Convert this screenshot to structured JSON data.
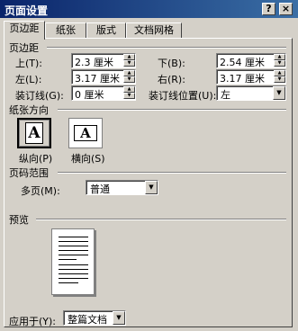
{
  "window": {
    "title": "页面设置"
  },
  "title_buttons": {
    "help": "?",
    "close": "×"
  },
  "tabs": [
    {
      "label": "页边距",
      "active": true
    },
    {
      "label": "纸张",
      "active": false
    },
    {
      "label": "版式",
      "active": false
    },
    {
      "label": "文档网格",
      "active": false
    }
  ],
  "margins": {
    "section_label": "页边距",
    "top": {
      "label": "上(T):",
      "value": "2.3 厘米"
    },
    "bottom": {
      "label": "下(B):",
      "value": "2.54 厘米"
    },
    "left": {
      "label": "左(L):",
      "value": "3.17 厘米"
    },
    "right": {
      "label": "右(R):",
      "value": "3.17 厘米"
    },
    "gutter": {
      "label": "装订线(G):",
      "value": "0 厘米"
    },
    "gutter_position": {
      "label": "装订线位置(U):",
      "value": "左"
    }
  },
  "orientation": {
    "section_label": "纸张方向",
    "portrait": {
      "label": "纵向(P)",
      "glyph": "A",
      "selected": true
    },
    "landscape": {
      "label": "横向(S)",
      "glyph": "A",
      "selected": false
    }
  },
  "pages": {
    "section_label": "页码范围",
    "multiple_label": "多页(M):",
    "multiple_value": "普通"
  },
  "preview": {
    "section_label": "预览"
  },
  "apply": {
    "label": "应用于(Y):",
    "value": "整篇文档"
  }
}
